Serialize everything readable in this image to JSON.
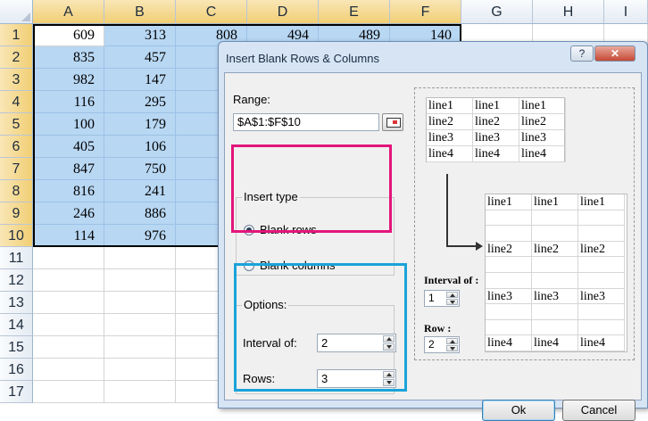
{
  "spreadsheet": {
    "columns": [
      "A",
      "B",
      "C",
      "D",
      "E",
      "F",
      "G",
      "H",
      "I"
    ],
    "rows": [
      "1",
      "2",
      "3",
      "4",
      "5",
      "6",
      "7",
      "8",
      "9",
      "10",
      "11",
      "12",
      "13",
      "14",
      "15",
      "16",
      "17"
    ],
    "data": [
      [
        "609",
        "313",
        "808",
        "494",
        "489",
        "140"
      ],
      [
        "835",
        "457",
        "",
        "",
        "",
        ""
      ],
      [
        "982",
        "147",
        "",
        "",
        "",
        ""
      ],
      [
        "116",
        "295",
        "",
        "",
        "",
        ""
      ],
      [
        "100",
        "179",
        "",
        "",
        "",
        ""
      ],
      [
        "405",
        "106",
        "",
        "",
        "",
        ""
      ],
      [
        "847",
        "750",
        "",
        "",
        "",
        ""
      ],
      [
        "816",
        "241",
        "",
        "",
        "",
        ""
      ],
      [
        "246",
        "886",
        "",
        "",
        "",
        ""
      ],
      [
        "114",
        "976",
        "",
        "",
        "",
        ""
      ]
    ]
  },
  "dialog": {
    "title": "Insert Blank Rows & Columns",
    "help_label": "?",
    "close_label": "✕",
    "range_label": "Range:",
    "range_value": "$A$1:$F$10",
    "insert_type": {
      "title": "Insert type",
      "options": [
        {
          "label": "Blank rows",
          "checked": true
        },
        {
          "label": "Blank columns",
          "checked": false
        }
      ]
    },
    "options_group": {
      "title": "Options:",
      "interval_label": "Interval of:",
      "interval_value": "2",
      "rows_label": "Rows:",
      "rows_value": "3"
    },
    "preview": {
      "before_rows": [
        [
          "line1",
          "line1",
          "line1"
        ],
        [
          "line2",
          "line2",
          "line2"
        ],
        [
          "line3",
          "line3",
          "line3"
        ],
        [
          "line4",
          "line4",
          "line4"
        ]
      ],
      "after_rows": [
        [
          "line1",
          "line1",
          "line1"
        ],
        [
          "",
          "",
          ""
        ],
        [
          "",
          "",
          ""
        ],
        [
          "line2",
          "line2",
          "line2"
        ],
        [
          "",
          "",
          ""
        ],
        [
          "",
          "",
          ""
        ],
        [
          "line3",
          "line3",
          "line3"
        ],
        [
          "",
          "",
          ""
        ],
        [
          "",
          "",
          ""
        ],
        [
          "line4",
          "line4",
          "line4"
        ]
      ],
      "interval_label": "Interval of :",
      "interval_value": "1",
      "row_label": "Row :",
      "row_value": "2"
    },
    "ok_label": "Ok",
    "cancel_label": "Cancel"
  },
  "colors": {
    "selection": "#b8d7f3",
    "insert_type_highlight": "#e3157a",
    "options_highlight": "#1aa3d9"
  }
}
